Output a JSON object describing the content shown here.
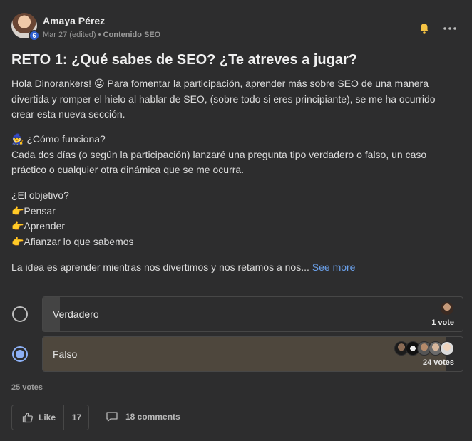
{
  "author": {
    "name": "Amaya Pérez",
    "level": "6",
    "date": "Mar 27 (edited)",
    "separator": "•",
    "category": "Contenido SEO"
  },
  "post": {
    "title": "RETO 1: ¿Qué sabes de SEO? ¿Te atreves a jugar?",
    "p1_text": "Hola Dinorankers! 😜 Para fomentar la participación, aprender más sobre SEO de una manera divertida y romper el hielo al hablar de SEO, (sobre todo si eres principiante), se me ha ocurrido crear esta nueva sección.",
    "p2_heading": "🧙 ¿Cómo funciona?",
    "p2_text": "Cada dos días (o según la participación) lanzaré una pregunta tipo verdadero o falso, un caso práctico o cualquier otra dinámica que se me ocurra.",
    "p3_heading": "¿El objetivo?",
    "p3_items": [
      "👉Pensar",
      "👉Aprender",
      "👉Afianzar lo que sabemos"
    ],
    "p4_text": "La idea es aprender mientras nos divertimos y nos retamos a nos...",
    "see_more": "See more"
  },
  "poll": {
    "options": [
      {
        "label": "Verdadero",
        "votes_text": "1 vote",
        "share": 0.04,
        "selected": false
      },
      {
        "label": "Falso",
        "votes_text": "24 votes",
        "share": 0.96,
        "selected": true
      }
    ],
    "total": "25 votes"
  },
  "footer": {
    "like_label": "Like",
    "like_count": "17",
    "comments_label": "18 comments"
  },
  "colors": {
    "background": "#2d2d2e",
    "link": "#6aa0ea",
    "selected_radio": "#8db0f5",
    "bell": "#f5c344"
  }
}
